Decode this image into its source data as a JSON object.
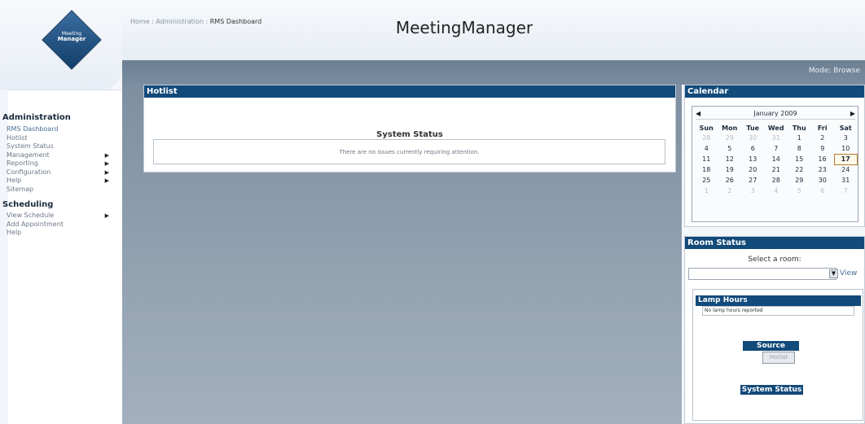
{
  "app": {
    "title": "MeetingManager",
    "logo_line1": "Meeting",
    "logo_line2": "Manager"
  },
  "breadcrumb": {
    "home": "Home",
    "sep1": " : ",
    "admin": "Administration",
    "sep2": " : ",
    "current": "RMS Dashboard"
  },
  "mode": {
    "text": "Mode: Browse"
  },
  "sidebar": {
    "admin_heading": "Administration",
    "admin_items": [
      {
        "label": "RMS Dashboard",
        "active": true,
        "submenu": false
      },
      {
        "label": "Hotlist",
        "submenu": false
      },
      {
        "label": "System Status",
        "submenu": false
      },
      {
        "label": "Management",
        "submenu": true
      },
      {
        "label": "Reporting",
        "submenu": true
      },
      {
        "label": "Configuration",
        "submenu": true
      },
      {
        "label": "Help",
        "submenu": true
      },
      {
        "label": "Sitemap",
        "submenu": false
      }
    ],
    "sched_heading": "Scheduling",
    "sched_items": [
      {
        "label": "View Schedule",
        "submenu": true
      },
      {
        "label": "Add Appointment",
        "submenu": false
      },
      {
        "label": "Help",
        "submenu": false
      }
    ],
    "arrow_glyph": "▶"
  },
  "hotlist": {
    "title": "Hotlist",
    "system_status_title": "System Status",
    "system_status_message": "There are no issues currently requiring attention."
  },
  "calendar": {
    "title": "Calendar",
    "prev": "◀",
    "next": "▶",
    "month_label": "January 2009",
    "weekdays": [
      "Sun",
      "Mon",
      "Tue",
      "Wed",
      "Thu",
      "Fri",
      "Sat"
    ],
    "weeks": [
      [
        "28",
        "29",
        "30",
        "31",
        "1",
        "2",
        "3"
      ],
      [
        "4",
        "5",
        "6",
        "7",
        "8",
        "9",
        "10"
      ],
      [
        "11",
        "12",
        "13",
        "14",
        "15",
        "16",
        "17"
      ],
      [
        "18",
        "19",
        "20",
        "21",
        "22",
        "23",
        "24"
      ],
      [
        "25",
        "26",
        "27",
        "28",
        "29",
        "30",
        "31"
      ],
      [
        "1",
        "2",
        "3",
        "4",
        "5",
        "6",
        "7"
      ]
    ],
    "today": "17"
  },
  "room_status": {
    "title": "Room Status",
    "select_label": "Select a room:",
    "select_value": "",
    "dropdown_glyph": "▼",
    "view_label": "View",
    "lamp_hours_title": "Lamp Hours",
    "lamp_hours_message": "No lamp hours reported",
    "source_usage_title": "Source Usage",
    "hotlist_button": "Hotlist",
    "system_status_title": "System Status"
  },
  "colors": {
    "header_blue": "#124a7a",
    "main_gray": "#8d9dae",
    "link_blue": "#4a6d96"
  }
}
